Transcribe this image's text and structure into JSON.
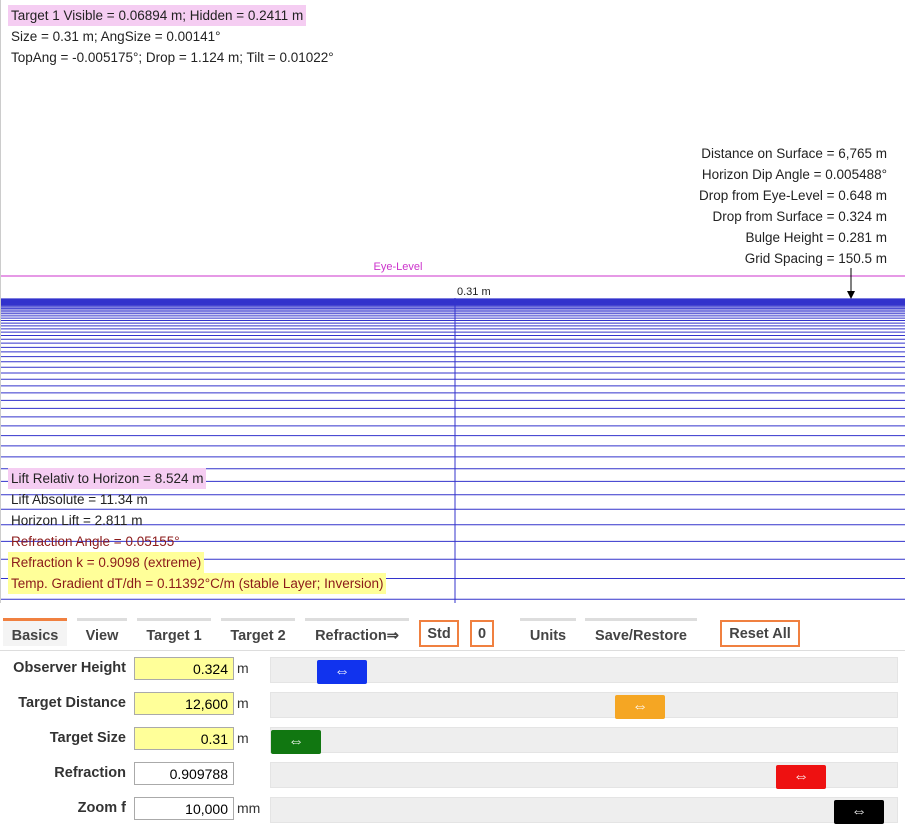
{
  "overlay_top": {
    "line1": "Target 1 Visible = 0.06894 m; Hidden = 0.2411 m",
    "line2": "Size  = 0.31 m; AngSize = 0.00141°",
    "line3": "TopAng = -0.005175°; Drop = 1.124 m; Tilt = 0.01022°"
  },
  "overlay_right": [
    "Distance on Surface = 6,765 m",
    "Horizon Dip Angle = 0.005488°",
    "Drop from Eye-Level = 0.648 m",
    "Drop from Surface = 0.324 m",
    "Bulge Height = 0.281 m",
    "Grid Spacing = 150.5 m"
  ],
  "eye_level_label": "Eye-Level",
  "target_label": "0.31 m",
  "overlay_bottom": {
    "lift_relative": "Lift Relativ to Horizon = 8.524 m",
    "lift_absolute": "Lift Absolute = 11.34 m",
    "horizon_lift": "Horizon Lift = 2.811 m",
    "refraction_angle": "Refraction Angle = 0.05155°",
    "refraction_k": "Refraction k = 0.9098 (extreme)",
    "temp_gradient": "Temp. Gradient dT/dh = 0.11392°C/m (stable Layer; Inversion)"
  },
  "colors": {
    "eye_level": "#cc33cc",
    "grid": "#3333cc",
    "accent": "#f08040",
    "observer_knob": "#1133ee",
    "distance_knob": "#f5a623",
    "size_knob": "#117711",
    "refraction_knob": "#ee1111",
    "zoom_knob": "#000000",
    "input_highlight": "#ffff99"
  },
  "tabs": [
    "Basics",
    "View",
    "Target 1",
    "Target 2",
    "Refraction⇒",
    "Std",
    "0",
    "Units",
    "Save/Restore",
    "Reset All"
  ],
  "controls": {
    "observer_height": {
      "label": "Observer Height",
      "value": "0.324",
      "unit": "m",
      "slider_fraction": 0.08
    },
    "target_distance": {
      "label": "Target Distance",
      "value": "12,600",
      "unit": "m",
      "slider_fraction": 0.6
    },
    "target_size": {
      "label": "Target Size",
      "value": "0.31",
      "unit": "m",
      "slider_fraction": 0.0
    },
    "refraction": {
      "label": "Refraction",
      "value": "0.909788",
      "unit": "",
      "slider_fraction": 0.88
    },
    "zoom": {
      "label": "Zoom f",
      "value": "10,000",
      "unit": "mm",
      "slider_fraction": 0.98
    }
  },
  "knob_glyph": "⇔"
}
